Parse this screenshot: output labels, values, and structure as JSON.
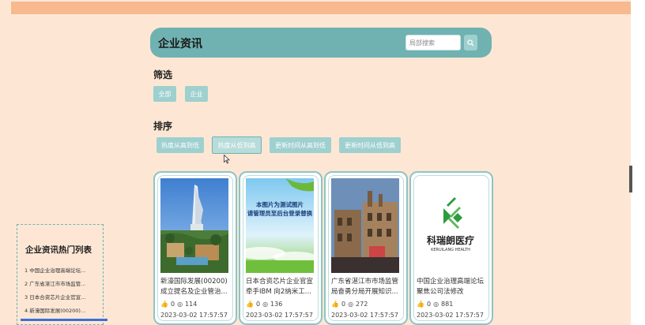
{
  "header": {
    "title": "企业资讯",
    "search_placeholder": "局部搜索"
  },
  "filter": {
    "title": "筛选",
    "options": [
      "全部",
      "企业"
    ]
  },
  "sort": {
    "title": "排序",
    "options": [
      "热度从高到低",
      "热度从低到高",
      "更新时间从高到低",
      "更新时间从低到高"
    ]
  },
  "cards": [
    {
      "title": "新濠国际发展(00200)成立提名及企业管治...",
      "likes": "0",
      "views": "114",
      "date": "2023-03-02 17:57:57",
      "image": "burj-al-arab-photo"
    },
    {
      "title": "日本合资芯片企业官宣牵手IBM 向2纳米工...",
      "likes": "0",
      "views": "136",
      "date": "2023-03-02 17:57:57",
      "image": "placeholder-test-image",
      "image_text_line1": "本图片为测试图片",
      "image_text_line2": "请管理员至后台登录替换"
    },
    {
      "title": "广东省湛江市市场监管局奋勇分局开展知识...",
      "likes": "0",
      "views": "272",
      "date": "2023-03-02 17:57:57",
      "image": "old-street-photo"
    },
    {
      "title": "中国企业治理高端论坛聚焦公司法修改",
      "likes": "0",
      "views": "881",
      "date": "2023-03-02 17:57:57",
      "image": "keruilang-logo",
      "logo_cn": "科瑞朗医疗",
      "logo_en": "KERUILANG HEALTH"
    }
  ],
  "hot_list": {
    "title": "企业资讯热门列表",
    "items": [
      "1 中国企业治理高端论坛...",
      "2 广东省湛江市市场监管...",
      "3 日本合资芯片企业官宣...",
      "4 新濠国际发展(00200)..."
    ]
  },
  "colors": {
    "teal": "#6fb2b1",
    "chip": "#9ed0cf",
    "background": "#fde7d4",
    "topbar": "#f7b98d"
  }
}
